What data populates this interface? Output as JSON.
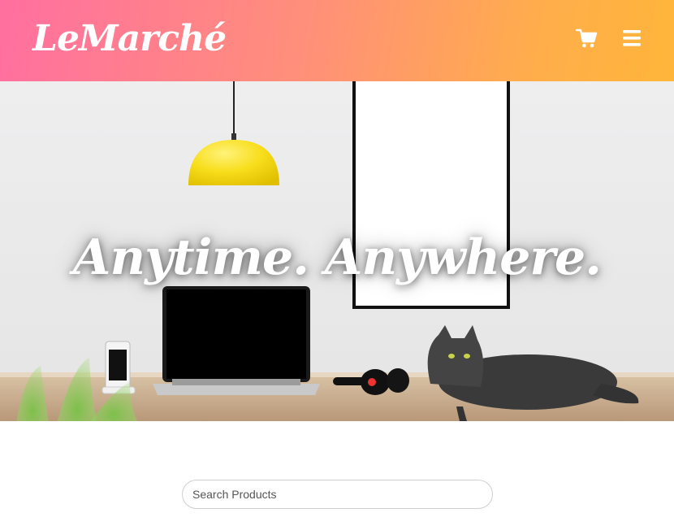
{
  "header": {
    "logo": "LeMarché",
    "cart_icon": "shopping-cart-icon",
    "menu_icon": "hamburger-menu-icon",
    "gradient": [
      "#ff6fa0",
      "#ffb53a"
    ]
  },
  "hero": {
    "headline": "Anytime. Anywhere."
  },
  "search": {
    "placeholder": "Search Products",
    "value": ""
  }
}
